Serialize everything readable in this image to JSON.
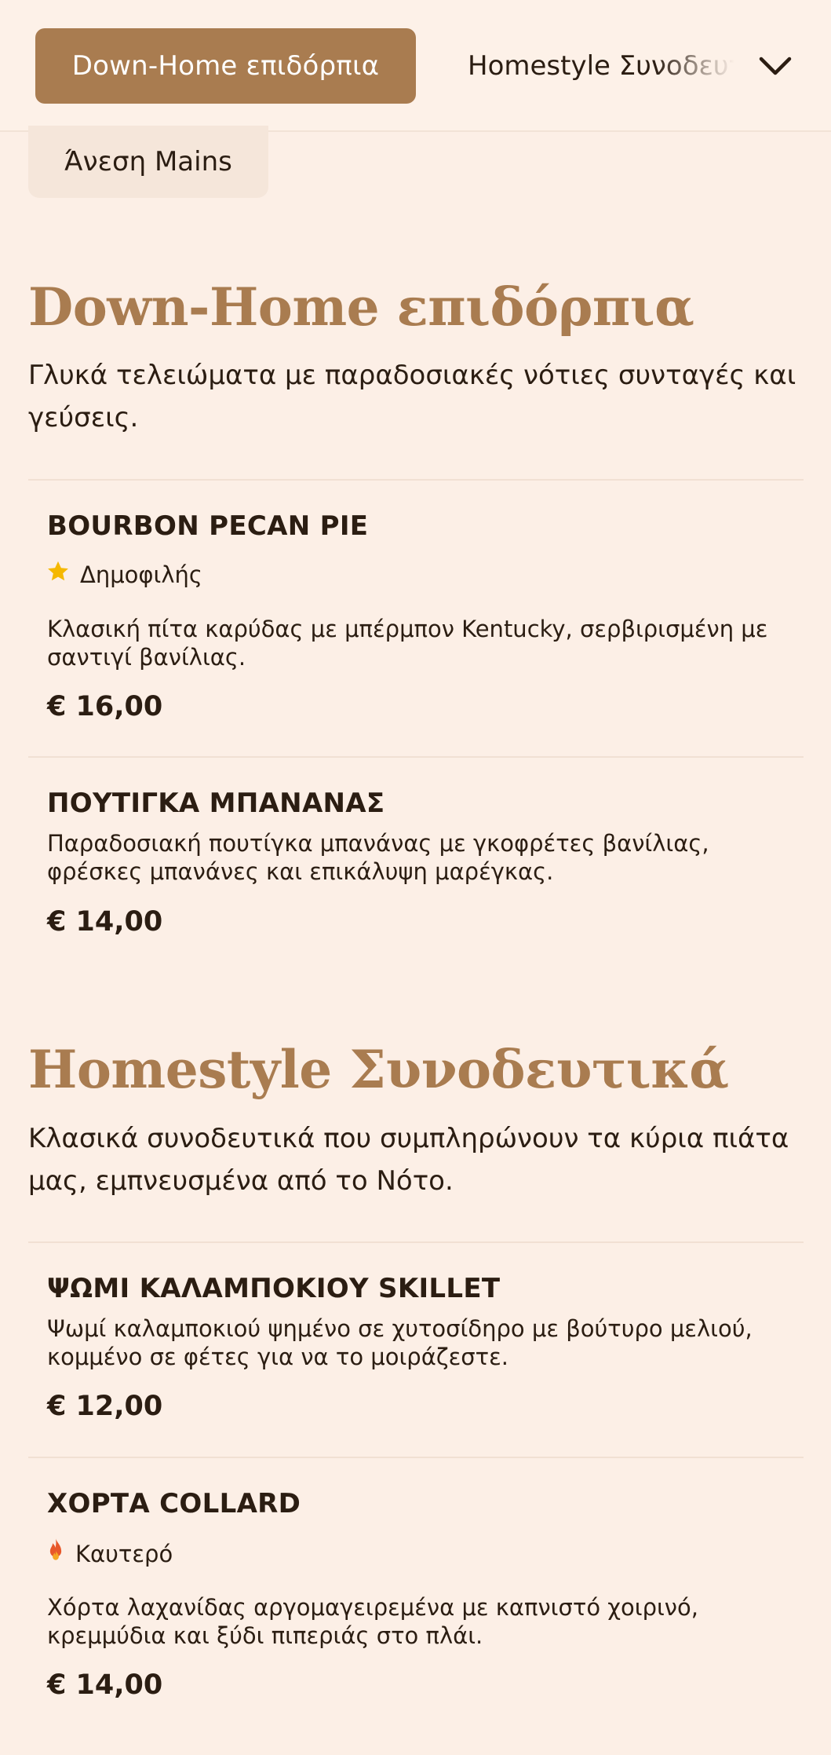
{
  "categories": {
    "active": "Down-Home επιδόρπια",
    "next": "Homestyle Συνοδευτικά",
    "chip": "Άνεση Mains"
  },
  "sections": [
    {
      "title": "Down-Home επιδόρπια",
      "description": "Γλυκά τελειώματα με παραδοσιακές νότιες συνταγές και γεύσεις.",
      "items": [
        {
          "name": "BOURBON PECAN PIE",
          "badge": "Δημοφιλής",
          "badge_icon": "star-icon",
          "description": "Κλασική πίτα καρύδας με μπέρμπον Kentucky, σερβιρισμένη με σαντιγί βανίλιας.",
          "price": "€ 16,00"
        },
        {
          "name": "ΠΟΥΤΙΓΚΑ ΜΠΑΝΑΝΑΣ",
          "description": "Παραδοσιακή πουτίγκα μπανάνας με γκοφρέτες βανίλιας, φρέσκες μπανάνες και επικάλυψη μαρέγκας.",
          "price": "€ 14,00"
        }
      ]
    },
    {
      "title": "Homestyle Συνοδευτικά",
      "description": "Κλασικά συνοδευτικά που συμπληρώνουν τα κύρια πιάτα μας, εμπνευσμένα από το Νότο.",
      "items": [
        {
          "name": "ΨΩΜΙ ΚΑΛΑΜΠΟΚΙΟΥ SKILLET",
          "description": "Ψωμί καλαμποκιού ψημένο σε χυτοσίδηρο με βούτυρο μελιού, κομμένο σε φέτες για να το μοιράζεστε.",
          "price": "€ 12,00"
        },
        {
          "name": "ΧΟΡΤΑ COLLARD",
          "badge": "Καυτερό",
          "badge_icon": "flame-icon",
          "description": "Χόρτα λαχανίδας αργομαγειρεμένα με καπνιστό χοιρινό, κρεμμύδια και ξύδι πιπεριάς στο πλάι.",
          "price": "€ 14,00"
        }
      ]
    }
  ],
  "colors": {
    "accent": "#a97c50",
    "background": "#fcefe6",
    "star": "#f5b800",
    "flame": "#e8582a"
  }
}
